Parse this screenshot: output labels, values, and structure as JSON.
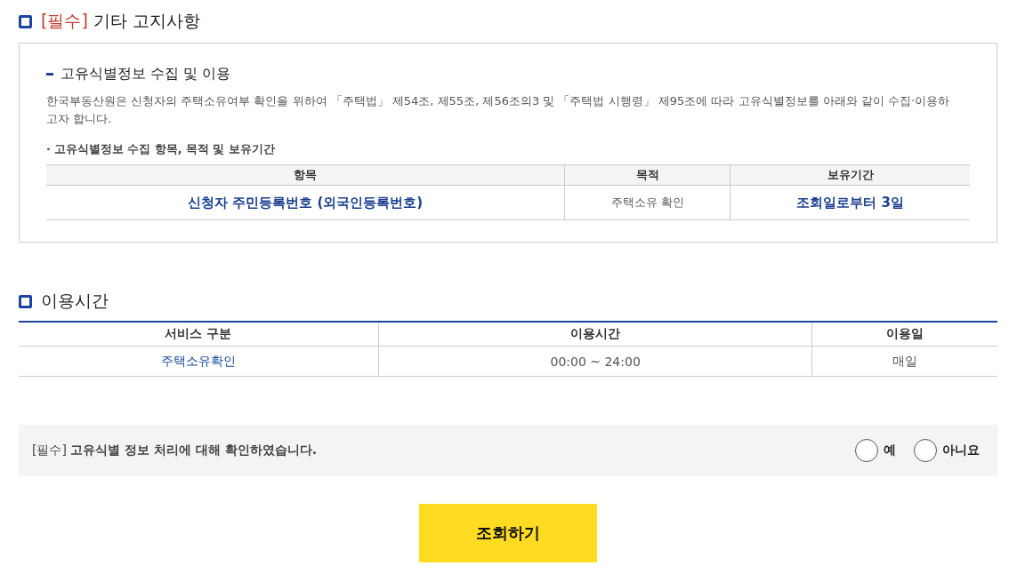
{
  "notice_section": {
    "tag": "[필수]",
    "title": "기타 고지사항",
    "subsection_title": "고유식별정보 수집 및 이용",
    "description": "한국부동산원은 신청자의 주택소유여부 확인을 위하여 「주택법」 제54조, 제55조, 제56조의3 및 「주택법 시행령」 제95조에 따라 고유식별정보를 아래와 같이 수집·이용하고자 합니다.",
    "list_title": "· 고유식별정보 수집 항목, 목적 및 보유기간",
    "table": {
      "columns": [
        "항목",
        "목적",
        "보유기간"
      ],
      "rows": [
        [
          {
            "text": "신청자 주민등록번호 (외국인등록번호)",
            "emphasis": true
          },
          {
            "text": "주택소유 확인",
            "emphasis": false
          },
          {
            "text": "조회일로부터 3일",
            "emphasis": true
          }
        ]
      ]
    }
  },
  "hours_section": {
    "title": "이용시간",
    "table": {
      "columns": [
        "서비스 구분",
        "이용시간",
        "이용일"
      ],
      "rows": [
        [
          {
            "text": "주택소유확인",
            "kind": "link"
          },
          {
            "text": "00:00 ~ 24:00",
            "kind": "plain"
          },
          {
            "text": "매일",
            "kind": "plain"
          }
        ]
      ]
    }
  },
  "confirm": {
    "text": "[필수] **고유식별 정보 처리에 대해 확인하였습니다.**",
    "options": [
      {
        "label": "예",
        "selected": false
      },
      {
        "label": "아니요",
        "selected": false
      }
    ]
  },
  "submit_button": "조회하기"
}
